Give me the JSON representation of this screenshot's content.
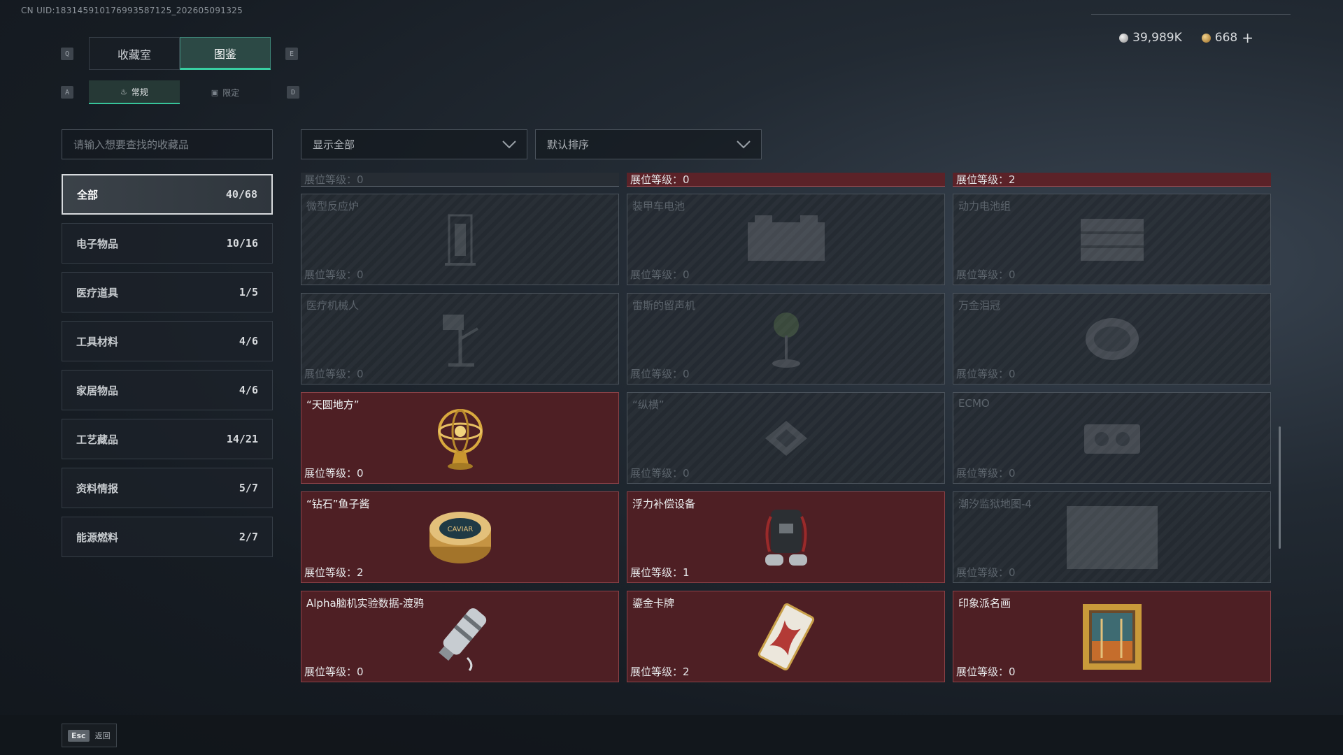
{
  "uid": "CN UID:183145910176993587125_202605091325",
  "currency": {
    "silver": "39,989K",
    "gold": "668",
    "add": "+"
  },
  "keys": {
    "q": "Q",
    "e": "E",
    "a": "A",
    "d": "D",
    "esc": "Esc"
  },
  "tabs": [
    {
      "label": "收藏室",
      "active": false
    },
    {
      "label": "图鉴",
      "active": true
    }
  ],
  "subtabs": [
    {
      "label": "常规",
      "active": true
    },
    {
      "label": "限定",
      "active": false
    }
  ],
  "search": {
    "placeholder": "请输入想要查找的收藏品"
  },
  "filter": {
    "value": "显示全部"
  },
  "sort": {
    "value": "默认排序"
  },
  "categories": [
    {
      "label": "全部",
      "count": "40/68",
      "active": true
    },
    {
      "label": "电子物品",
      "count": "10/16"
    },
    {
      "label": "医疗道具",
      "count": "1/5"
    },
    {
      "label": "工具材料",
      "count": "4/6"
    },
    {
      "label": "家居物品",
      "count": "4/6"
    },
    {
      "label": "工艺藏品",
      "count": "14/21"
    },
    {
      "label": "资料情报",
      "count": "5/7"
    },
    {
      "label": "能源燃料",
      "count": "2/7"
    }
  ],
  "partial_row": [
    {
      "level": "展位等级：0",
      "owned": false
    },
    {
      "level": "展位等级：0",
      "owned": true
    },
    {
      "level": "展位等级：2",
      "owned": true
    }
  ],
  "items": [
    {
      "name": "微型反应炉",
      "level": "展位等级：0",
      "owned": false,
      "icon": "reactor-icon"
    },
    {
      "name": "装甲车电池",
      "level": "展位等级：0",
      "owned": false,
      "icon": "battery-icon"
    },
    {
      "name": "动力电池组",
      "level": "展位等级：0",
      "owned": false,
      "icon": "battery-pack-icon"
    },
    {
      "name": "医疗机械人",
      "level": "展位等级：0",
      "owned": false,
      "icon": "medical-robot-icon"
    },
    {
      "name": "雷斯的留声机",
      "level": "展位等级：0",
      "owned": false,
      "icon": "phonograph-icon"
    },
    {
      "name": "万金泪冠",
      "level": "展位等级：0",
      "owned": false,
      "icon": "crown-icon"
    },
    {
      "name": "“天圆地方”",
      "level": "展位等级：0",
      "owned": true,
      "icon": "armillary-sphere-icon"
    },
    {
      "name": "“纵横”",
      "level": "展位等级：0",
      "owned": false,
      "icon": "chessboard-icon"
    },
    {
      "name": "ECMO",
      "level": "展位等级：0",
      "owned": false,
      "icon": "ecmo-icon"
    },
    {
      "name": "“钻石”鱼子酱",
      "level": "展位等级：2",
      "owned": true,
      "icon": "caviar-tin-icon"
    },
    {
      "name": "浮力补偿设备",
      "level": "展位等级：1",
      "owned": true,
      "icon": "buoyancy-device-icon"
    },
    {
      "name": "潮汐监狱地图-4",
      "level": "展位等级：0",
      "owned": false,
      "icon": "map-icon"
    },
    {
      "name": "Alpha脑机实验数据-渡鸦",
      "level": "展位等级：0",
      "owned": true,
      "icon": "data-drive-icon"
    },
    {
      "name": "鎏金卡牌",
      "level": "展位等级：2",
      "owned": true,
      "icon": "gilded-card-icon"
    },
    {
      "name": "印象派名画",
      "level": "展位等级：0",
      "owned": true,
      "icon": "painting-icon"
    }
  ],
  "caviar_label": "CAVIAR",
  "esc_label": "返回"
}
